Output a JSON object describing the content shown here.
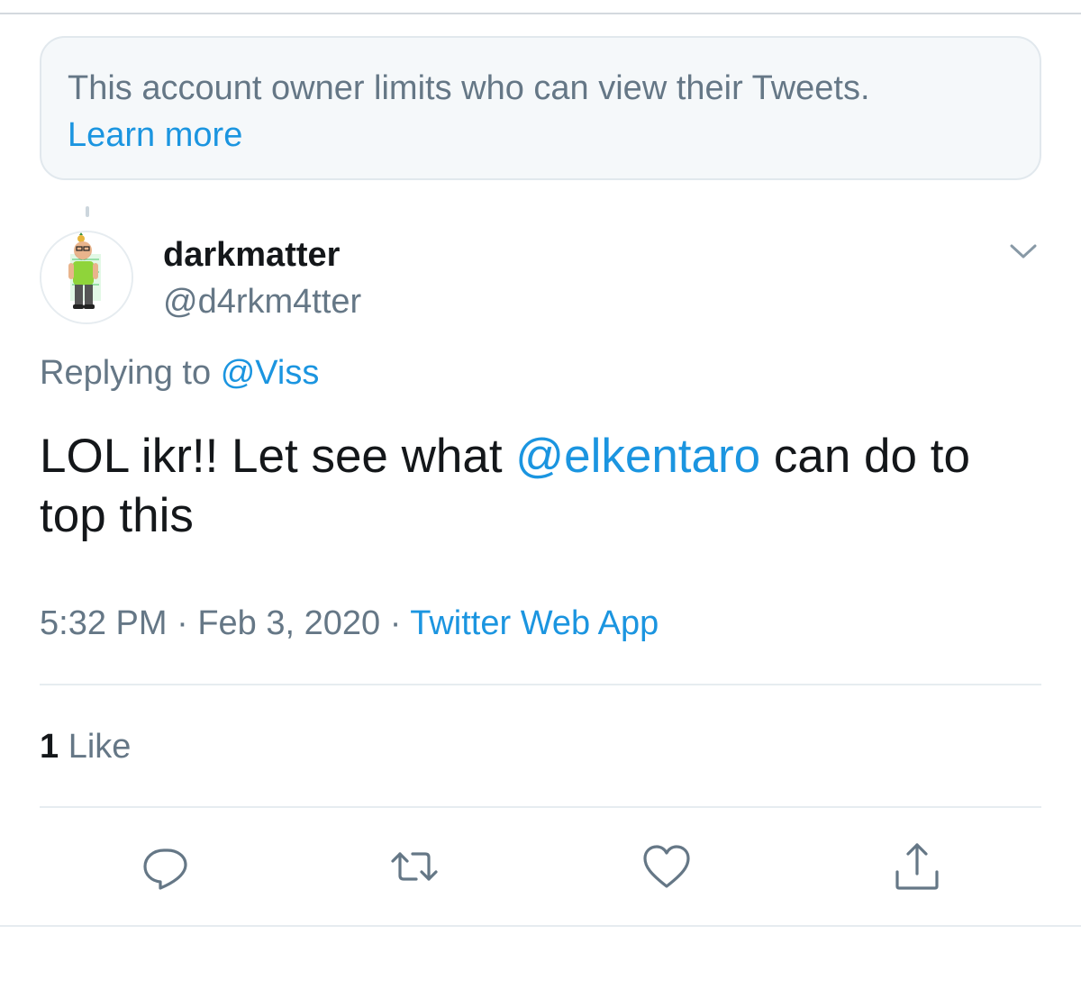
{
  "notice": {
    "text": "This account owner limits who can view their Tweets.",
    "link": "Learn more"
  },
  "tweet": {
    "display_name": "darkmatter",
    "handle": "@d4rkm4tter",
    "replying_prefix": "Replying to",
    "replying_to": "@Viss",
    "text_before": "LOL ikr!! Let see what ",
    "text_mention": "@elkentaro",
    "text_after": " can do to top this",
    "time": "5:32 PM",
    "separator_1": " · ",
    "date": "Feb 3, 2020",
    "separator_2": " · ",
    "source": "Twitter Web App",
    "like_count": "1",
    "like_label": "Like"
  },
  "icons": {
    "more": "chevron-down-icon",
    "reply": "reply-icon",
    "retweet": "retweet-icon",
    "like": "heart-icon",
    "share": "share-icon"
  },
  "colors": {
    "accent": "#1b95e0",
    "secondary_text": "#657786",
    "primary_text": "#14171a",
    "notice_bg": "#f5f8fa"
  }
}
